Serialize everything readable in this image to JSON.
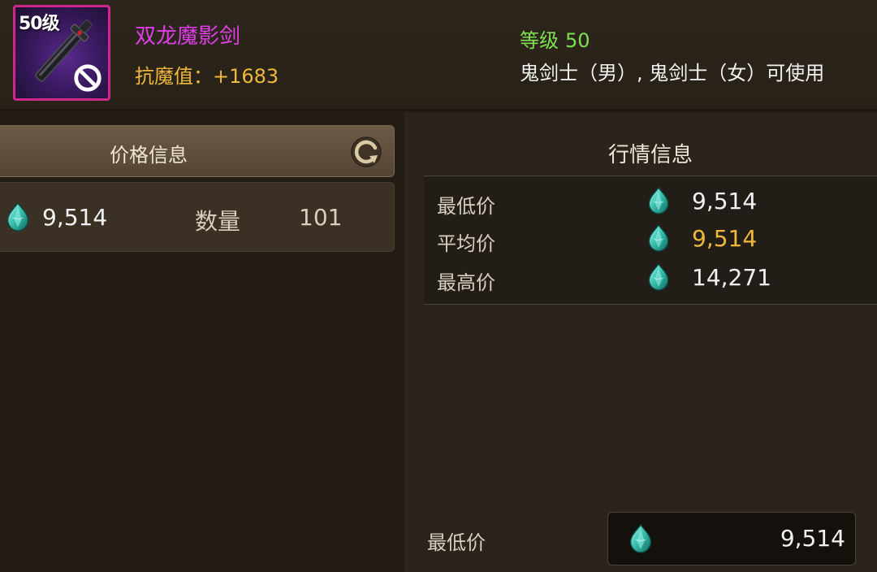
{
  "item": {
    "level_badge": "50级",
    "name": "双龙魔影剑",
    "stat": "抗魔值：+1683",
    "level_label": "等级",
    "level_value": "50",
    "usable_by": "鬼剑士（男）, 鬼剑士（女）可使用",
    "name_color": "#e03ee6",
    "stat_color": "#f0b83a",
    "level_color": "#7fe04f",
    "icon": "sword-icon",
    "restriction_icon": "ban-icon"
  },
  "price_info": {
    "tab_label": "价格信息",
    "refresh_icon": "refresh-icon",
    "listing": {
      "currency_icon": "gem-icon",
      "price": "9,514",
      "quantity_label": "数量",
      "quantity": "101"
    }
  },
  "market_info": {
    "title": "行情信息",
    "rows": [
      {
        "label": "最低价",
        "currency_icon": "gem-icon",
        "value": "9,514"
      },
      {
        "label": "平均价",
        "currency_icon": "gem-icon",
        "value": "9,514"
      },
      {
        "label": "最高价",
        "currency_icon": "gem-icon",
        "value": "14,271"
      }
    ]
  },
  "bottom": {
    "label": "最低价",
    "currency_icon": "gem-icon",
    "value": "9,514"
  }
}
